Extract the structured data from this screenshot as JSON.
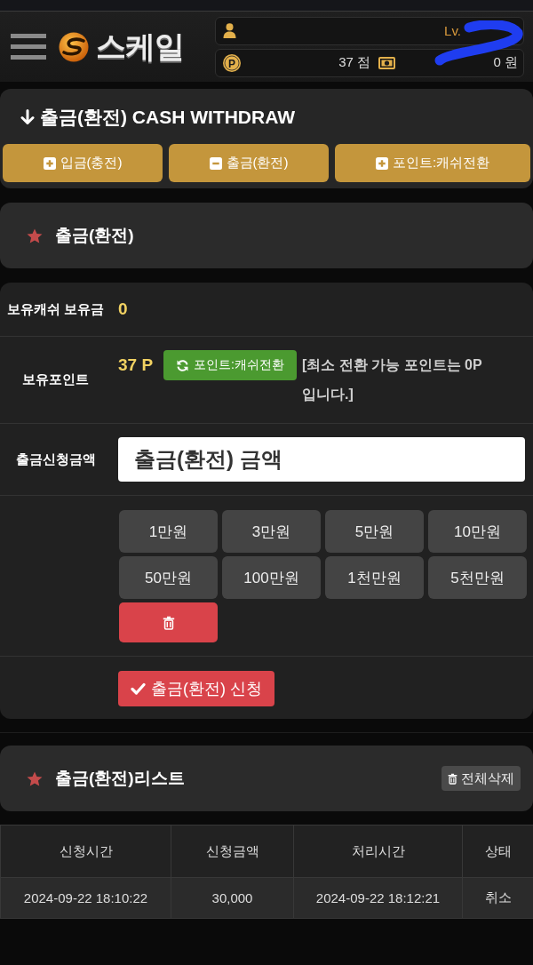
{
  "header": {
    "logo": {
      "text": "스케일"
    },
    "user": {
      "level": "Lv.",
      "redacted": true
    },
    "points": {
      "symbol": "P",
      "value": "37 점"
    },
    "cash": {
      "value": "0 원"
    }
  },
  "withdraw_panel": {
    "title": "출금(환전) CASH WITHDRAW",
    "buttons": [
      {
        "label": "입금(충전)",
        "kind": "plus"
      },
      {
        "label": "출금(환전)",
        "kind": "minus"
      },
      {
        "label": "포인트:캐쉬전환",
        "kind": "plus"
      }
    ]
  },
  "section": {
    "title": "출금(환전)"
  },
  "form": {
    "cash": {
      "label": "보유캐쉬 보유금",
      "value": "0"
    },
    "points": {
      "label": "보유포인트",
      "value": "37 P",
      "convert_button": "포인트:캐쉬전환",
      "note": "[최소 전환 가능 포인트는 0P 입니다.]"
    },
    "amount": {
      "label": "출금신청금액",
      "placeholder": "출금(환전) 금액"
    },
    "quick_amounts": [
      "1만원",
      "3만원",
      "5만원",
      "10만원",
      "50만원",
      "100만원",
      "1천만원",
      "5천만원"
    ],
    "submit_button": "출금(환전) 신청"
  },
  "history": {
    "title": "출금(환전)리스트",
    "delete_all_button": "전체삭제",
    "table": {
      "columns": [
        "신청시간",
        "신청금액",
        "처리시간",
        "상태"
      ],
      "rows": [
        [
          "2024-09-22 18:10:22",
          "30,000",
          "2024-09-22 18:12:21",
          "취소"
        ]
      ]
    }
  }
}
